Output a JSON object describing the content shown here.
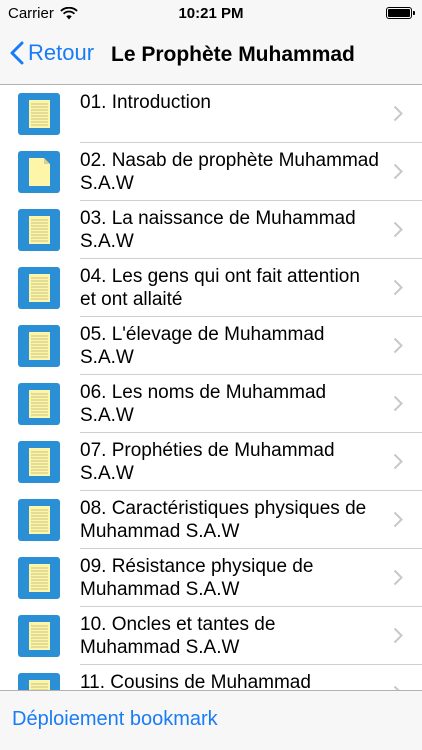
{
  "status_bar": {
    "carrier": "Carrier",
    "time": "10:21 PM"
  },
  "nav": {
    "back_label": "Retour",
    "title": "Le Prophète Muhammad"
  },
  "colors": {
    "accent": "#1a7cf5",
    "icon_blue": "#2b8fd6",
    "icon_paper": "#fdf6a8"
  },
  "items": [
    {
      "label": "01. Introduction",
      "icon": "notebook-icon"
    },
    {
      "label": "02. Nasab de prophète Muhammad S.A.W",
      "icon": "document-icon"
    },
    {
      "label": "03. La naissance de Muhammad S.A.W",
      "icon": "notebook-icon"
    },
    {
      "label": "04. Les gens qui ont fait attention et ont allaité",
      "icon": "notebook-icon"
    },
    {
      "label": "05. L'élevage de Muhammad S.A.W",
      "icon": "notebook-icon"
    },
    {
      "label": "06. Les noms de Muhammad S.A.W",
      "icon": "notebook-icon"
    },
    {
      "label": "07. Prophéties de Muhammad S.A.W",
      "icon": "notebook-icon"
    },
    {
      "label": "08. Caractéristiques physiques de Muhammad S.A.W",
      "icon": "notebook-icon"
    },
    {
      "label": "09. Résistance physique de Muhammad S.A.W",
      "icon": "notebook-icon"
    },
    {
      "label": "10. Oncles et tantes de Muhammad S.A.W",
      "icon": "notebook-icon"
    },
    {
      "label": "11. Cousins de Muhammad",
      "icon": "notebook-icon"
    }
  ],
  "bottom": {
    "bookmark_label": "Déploiement bookmark"
  }
}
